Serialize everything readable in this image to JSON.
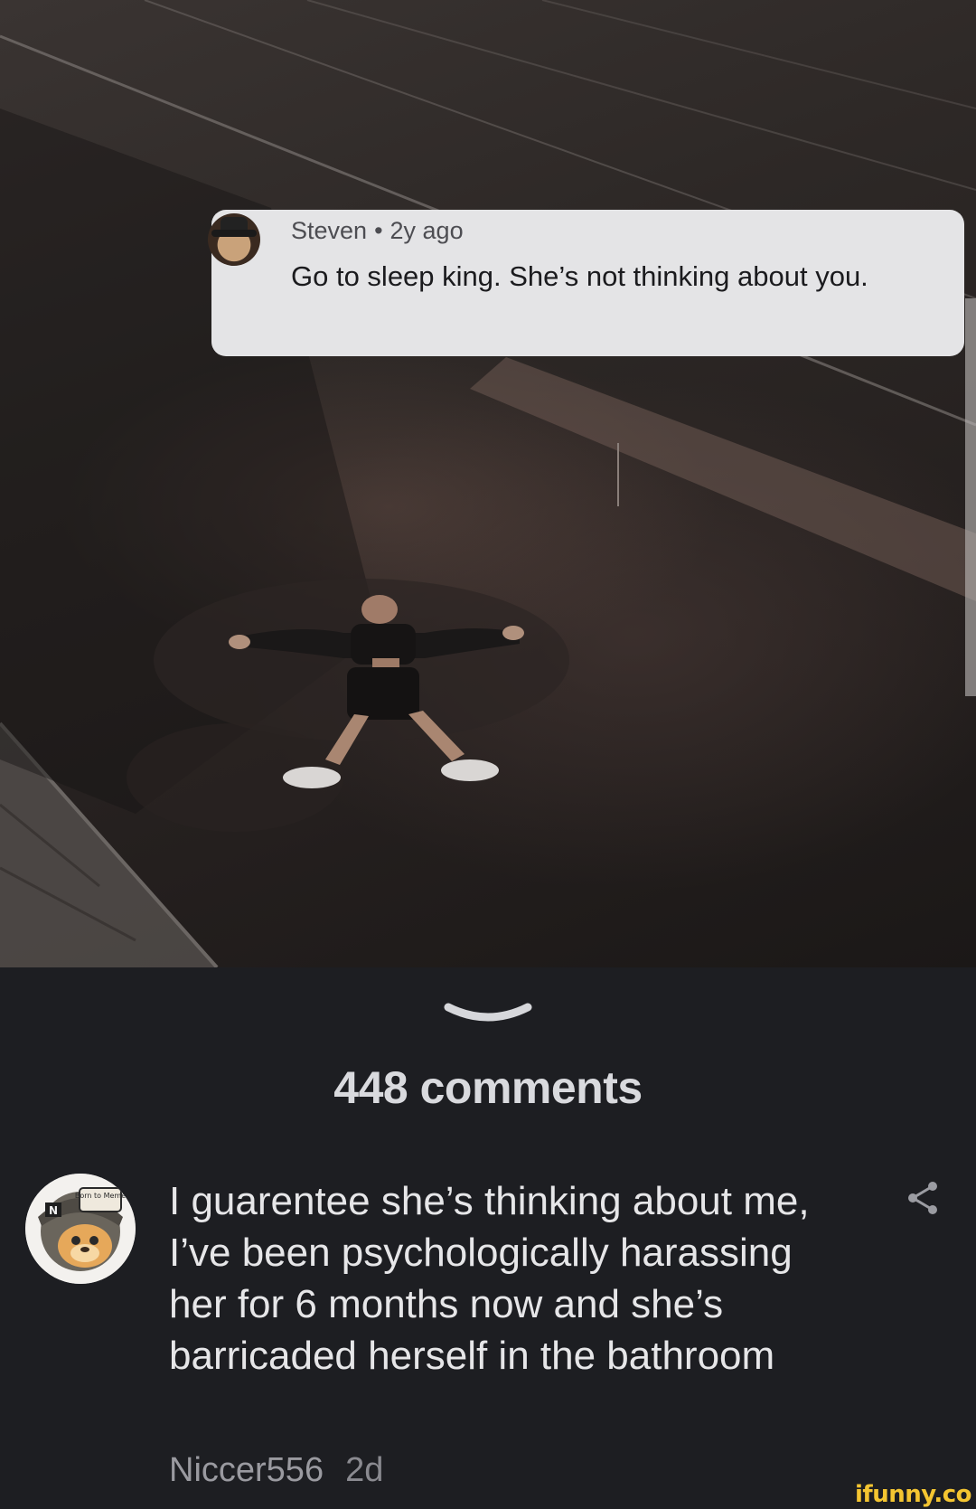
{
  "post": {
    "embedded_comment": {
      "username": "Steven",
      "separator": "•",
      "age": "2y ago",
      "text": "Go to sleep king. She’s not thinking about you."
    }
  },
  "comments_panel": {
    "count_label": "448 comments",
    "comments": [
      {
        "text": "I guarentee she’s thinking about me, I’ve been psychologically harassing her for 6 months now and she’s barricaded herself in the bathroom",
        "author": "Niccer556",
        "age": "2d",
        "avatar_badge": "Born to Meme",
        "avatar_letter": "N"
      }
    ]
  },
  "watermark": "ifunny.co",
  "icons": {
    "collapse": "chevron-down-icon",
    "share": "share-icon"
  },
  "colors": {
    "panel_bg": "#1d1e22",
    "card_bg": "#e4e4e6",
    "count_text": "#d9dade",
    "comment_text": "#e6e6e8",
    "author_text": "#9a9aa0",
    "watermark": "#f4c531"
  }
}
